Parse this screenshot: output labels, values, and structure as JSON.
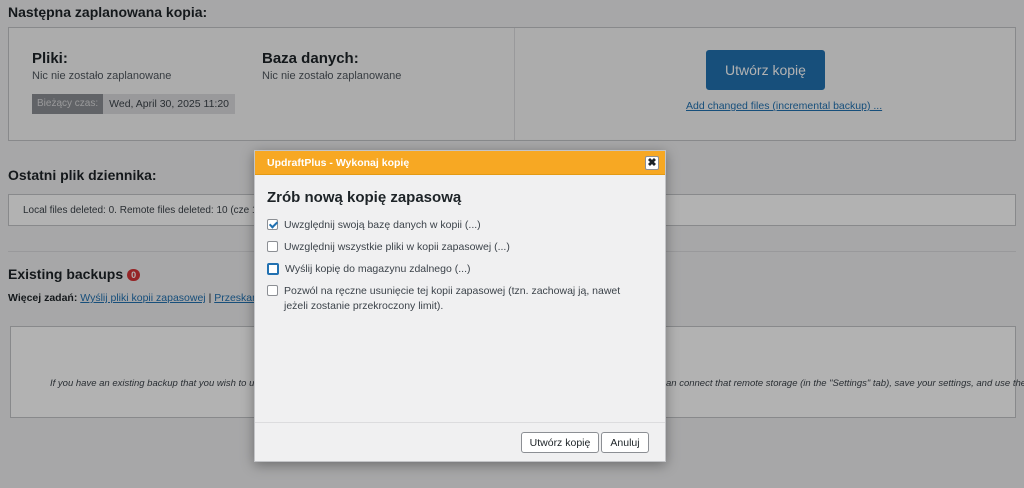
{
  "schedule": {
    "heading": "Następna zaplanowana kopia:",
    "files_title": "Pliki:",
    "files_sub": "Nic nie zostało zaplanowane",
    "db_title": "Baza danych:",
    "db_sub": "Nic nie zostało zaplanowane",
    "time_label": "Bieżący czas:",
    "time_value": "Wed, April 30, 2025 11:20",
    "create_button": "Utwórz kopię",
    "incremental_link": "Add changed files (incremental backup) ..."
  },
  "log": {
    "heading": "Ostatni plik dziennika:",
    "text": "Local files deleted: 0. Remote files deleted: 10 (cze 11 14:"
  },
  "backups": {
    "heading": "Existing backups",
    "count": "0",
    "more_tasks_label": "Więcej zadań:",
    "upload_link": "Wyślij pliki kopii zapasowej",
    "separator": "|",
    "rescan_link": "Przeskanuj pono",
    "info_left": "If you have an existing backup that you wish to upload",
    "info_right": "an connect that remote storage (in the \"Settings\" tab), save your settings, and use the"
  },
  "dialog": {
    "title": "UpdraftPlus - Wykonaj kopię",
    "close_glyph": "✖",
    "heading": "Zrób nową kopię zapasową",
    "options": [
      {
        "label": "Uwzględnij swoją bazę danych w kopii (...)",
        "checked": true
      },
      {
        "label": "Uwzględnij wszystkie pliki w kopii zapasowej (...)",
        "checked": false
      },
      {
        "label": "Wyślij kopię do magazynu zdalnego (...)",
        "checked": false
      },
      {
        "label": "Pozwól na ręczne usunięcie tej kopii zapasowej (tzn. zachowaj ją, nawet jeżeli zostanie przekroczony limit).",
        "checked": false
      }
    ],
    "confirm_button": "Utwórz kopię",
    "cancel_button": "Anuluj"
  }
}
